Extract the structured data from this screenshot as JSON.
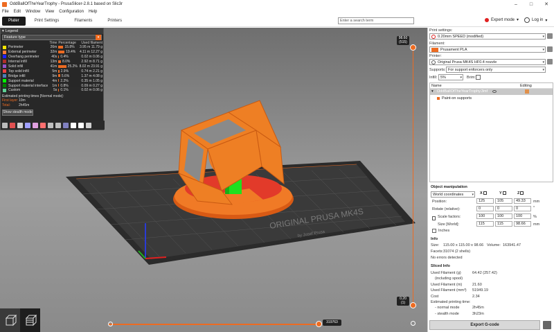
{
  "window": {
    "title": "OddBallOfTheYearTrophy - PrusaSlicer-2.8.1 based on Slic3r"
  },
  "menu": [
    "File",
    "Edit",
    "Window",
    "View",
    "Configuration",
    "Help"
  ],
  "tabs": {
    "plater": "Plater",
    "print_settings": "Print Settings",
    "filaments": "Filaments",
    "printers": "Printers"
  },
  "search": {
    "placeholder": "Enter a search term"
  },
  "mode": {
    "label": "Expert mode",
    "color": "#e02020"
  },
  "login": {
    "label": "Log in"
  },
  "legend": {
    "title": "Legend",
    "type": "Feature type",
    "headers": {
      "time": "Time",
      "percentage": "Percentage",
      "used": "Used filament"
    },
    "rows": [
      {
        "name": "Perimeter",
        "color": "#ffe600",
        "time": "26m",
        "pct": "15.8%",
        "pct_value": 15.8,
        "len": "3.95 m",
        "weight": "11.79 g"
      },
      {
        "name": "External perimeter",
        "color": "#ff7d38",
        "time": "32m",
        "pct": "19.4%",
        "pct_value": 19.4,
        "len": "4.11 m",
        "weight": "12.27 g"
      },
      {
        "name": "Overhang perimeter",
        "color": "#1f1fff",
        "time": "40s",
        "pct": "0.4%",
        "pct_value": 0.4,
        "len": "0.02 m",
        "weight": "0.06 g"
      },
      {
        "name": "Internal infill",
        "color": "#b03029",
        "time": "13m",
        "pct": "8.0%",
        "pct_value": 8.0,
        "len": "2.92 m",
        "weight": "8.71 g"
      },
      {
        "name": "Solid infill",
        "color": "#9654cc",
        "time": "41m",
        "pct": "25.2%",
        "pct_value": 25.2,
        "len": "8.02 m",
        "weight": "23.91 g"
      },
      {
        "name": "Top solid infill",
        "color": "#f04040",
        "time": "5m",
        "pct": "2.9%",
        "pct_value": 2.9,
        "len": "0.74 m",
        "weight": "2.21 g"
      },
      {
        "name": "Bridge infill",
        "color": "#4d80ba",
        "time": "9m",
        "pct": "5.6%",
        "pct_value": 5.6,
        "len": "1.37 m",
        "weight": "4.08 g"
      },
      {
        "name": "Support material",
        "color": "#00ff00",
        "time": "4m",
        "pct": "2.2%",
        "pct_value": 2.2,
        "len": "0.35 m",
        "weight": "1.05 g"
      },
      {
        "name": "Support material interface",
        "color": "#008000",
        "time": "1m",
        "pct": "0.8%",
        "pct_value": 0.8,
        "len": "0.09 m",
        "weight": "0.27 g"
      },
      {
        "name": "Custom",
        "color": "#5ed194",
        "time": "5s",
        "pct": "0.1%",
        "pct_value": 0.1,
        "len": "0.02 m",
        "weight": "0.06 g"
      }
    ],
    "est_title": "Estimated printing times [Normal mode]:",
    "first_layer_key": "First layer:",
    "first_layer_val": "10m",
    "total_key": "Total:",
    "total_val": "2h45m",
    "stealth_button": "Show stealth mode"
  },
  "vslider": {
    "top_label_1": "98.60",
    "top_label_2": "(515)",
    "bottom_label_1": "0.20",
    "bottom_label_2": "(1)"
  },
  "hslider": {
    "label": "319763"
  },
  "bed": {
    "brand_1": "ORIGINAL PRUSA MK4S",
    "brand_2": "by Josef Prusa"
  },
  "right": {
    "print_settings_label": "Print settings:",
    "print_settings_value": "0.20mm SPEED (modified)",
    "filament_label": "Filament:",
    "filament_value": "Prusament PLA",
    "filament_color": "#ed6b21",
    "printer_label": "Printer:",
    "printer_value": "Original Prusa MK4S HF0.4 nozzle",
    "supports_label": "Supports:",
    "supports_value": "For support enforcers only",
    "infill_label": "Infill:",
    "infill_value": "5%",
    "brim_label": "Brim:",
    "list_name_header": "Name",
    "list_editing_header": "Editing",
    "object_name": "OddBallOfTheYearTrophy.3mf",
    "child_name": "Paint-on supports",
    "obj_manip_title": "Object manipulation",
    "coord_value": "World coordinates",
    "axis_x": "X",
    "axis_y": "Y",
    "axis_z": "Z",
    "position_label": "Position:",
    "position": [
      "125",
      "105",
      "49.33"
    ],
    "position_unit": "mm",
    "rotate_label": "Rotate (relative):",
    "rotate": [
      "0",
      "0",
      "0"
    ],
    "rotate_unit": "°",
    "scale_label": "Scale factors:",
    "scale": [
      "100",
      "100",
      "100"
    ],
    "scale_unit": "%",
    "size_label": "Size [World]:",
    "size": [
      "115",
      "115",
      "98.66"
    ],
    "size_unit": "mm",
    "inches_label": "Inches",
    "info_title": "Info",
    "info_size_key": "Size:",
    "info_size_val": "115.00 x 115.00 x 98.66",
    "info_volume_key": "Volume:",
    "info_volume_val": "163941.47",
    "info_facets_key": "Facets:",
    "info_facets_val": "31074 (2 shells)",
    "info_errors": "No errors detected",
    "sliced_title": "Sliced Info",
    "sliced_rows": [
      {
        "k": "Used Filament (g)",
        "v": "64.42 (257.42)"
      },
      {
        "k": "(including spool)",
        "v": ""
      },
      {
        "k": "Used Filament (m)",
        "v": "21.60"
      },
      {
        "k": "Used Filament (mm³)",
        "v": "51949.19"
      },
      {
        "k": "Cost",
        "v": "2.34"
      },
      {
        "k": "Estimated printing time:",
        "v": ""
      },
      {
        "k": "- normal mode",
        "v": "2h45m"
      },
      {
        "k": "- stealth mode",
        "v": "3h23m"
      }
    ],
    "export_button": "Export G-code"
  }
}
